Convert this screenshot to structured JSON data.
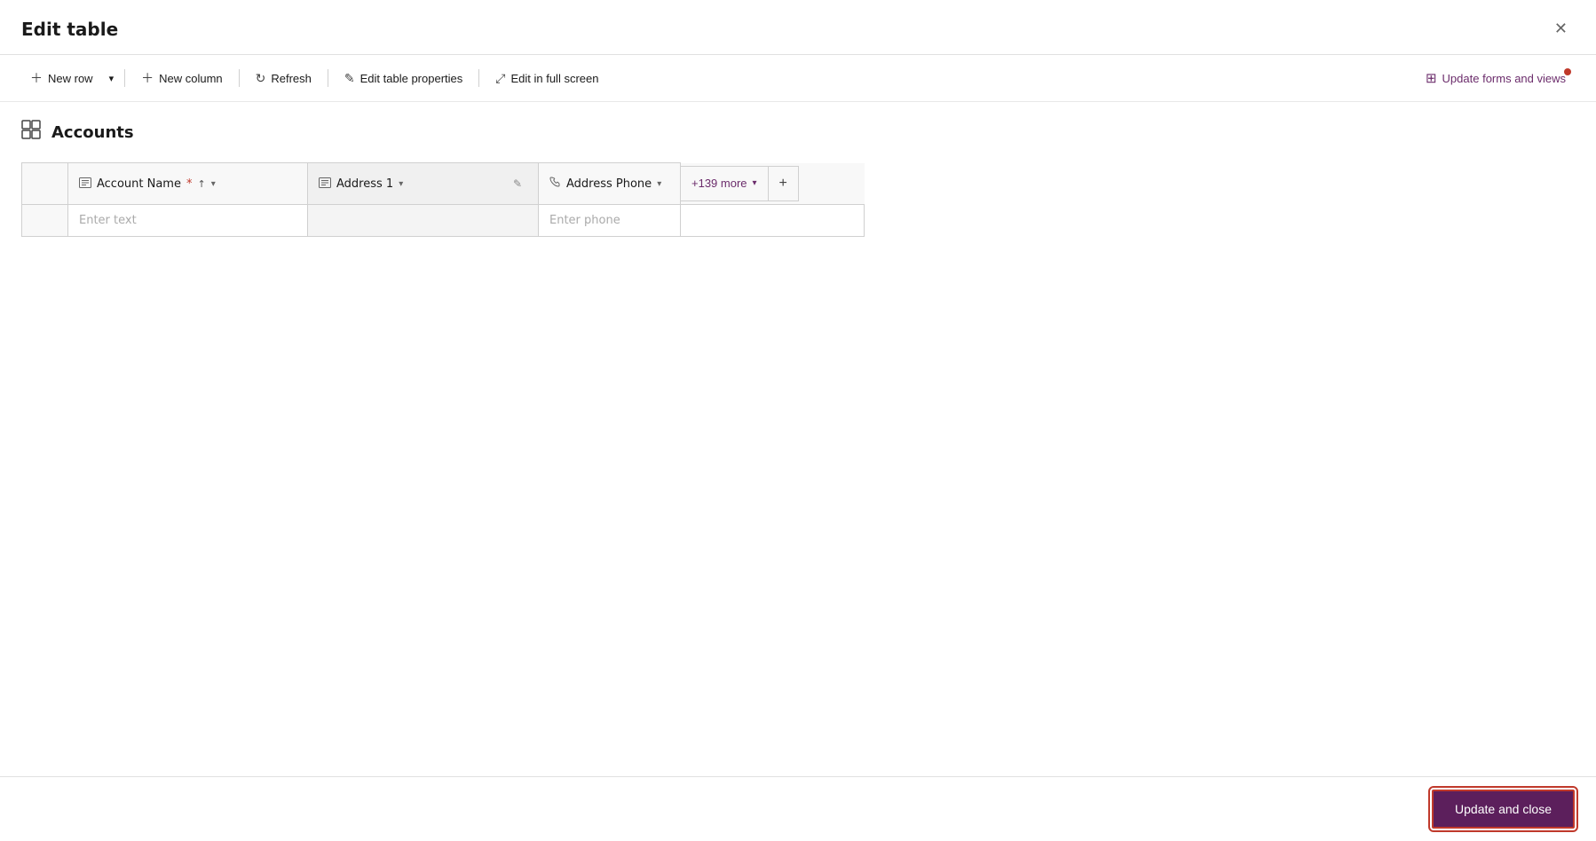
{
  "modal": {
    "title": "Edit table",
    "close_label": "✕"
  },
  "toolbar": {
    "new_row_label": "New row",
    "new_column_label": "New column",
    "refresh_label": "Refresh",
    "edit_table_properties_label": "Edit table properties",
    "edit_full_screen_label": "Edit in full screen",
    "update_forms_label": "Update forms and views"
  },
  "table": {
    "title": "Accounts",
    "columns": [
      {
        "id": "account_name",
        "label": "Account Name",
        "required": true,
        "icon": "text-icon",
        "sortable": true,
        "placeholder": "Enter text"
      },
      {
        "id": "address1",
        "label": "Address 1",
        "required": false,
        "icon": "text-icon",
        "sortable": false,
        "editable": true,
        "placeholder": ""
      },
      {
        "id": "address_phone",
        "label": "Address Phone",
        "required": false,
        "icon": "phone-icon",
        "sortable": false,
        "placeholder": "Enter phone"
      }
    ],
    "more_columns": "+139 more",
    "add_column_label": "+"
  },
  "footer": {
    "update_close_label": "Update and close"
  }
}
